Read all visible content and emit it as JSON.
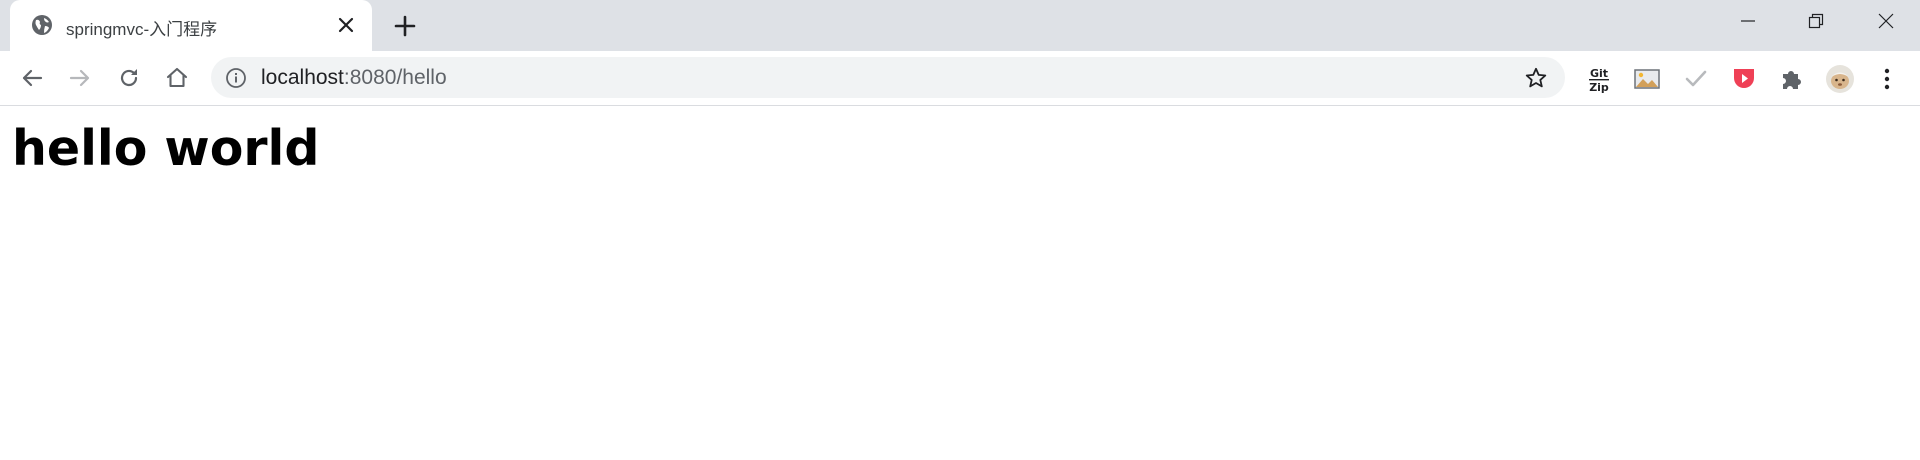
{
  "browser": {
    "tab": {
      "title": "springmvc-入门程序",
      "favicon": "globe-icon",
      "close_icon": "close-icon"
    },
    "new_tab_icon": "plus-icon",
    "window_controls": [
      "minimize-icon",
      "restore-icon",
      "close-icon"
    ],
    "toolbar": {
      "back_icon": "arrow-left-icon",
      "forward_icon": "arrow-right-icon",
      "reload_icon": "reload-icon",
      "home_icon": "home-icon",
      "site_info_icon": "info-icon",
      "url_host": "localhost",
      "url_rest": ":8080/hello",
      "bookmark_icon": "star-icon"
    },
    "extensions": {
      "gitzip_line1": "Git",
      "gitzip_line2": "Zip",
      "icons": [
        "gitzip-icon",
        "image-icon",
        "checkmark-icon",
        "pocket-icon",
        "puzzle-icon",
        "avatar",
        "menu-dots-icon"
      ]
    }
  },
  "page": {
    "heading": "hello world"
  },
  "colors": {
    "tabstrip_bg": "#dee1e6",
    "omnibox_bg": "#f1f3f4",
    "pocket_red": "#ef4056"
  }
}
